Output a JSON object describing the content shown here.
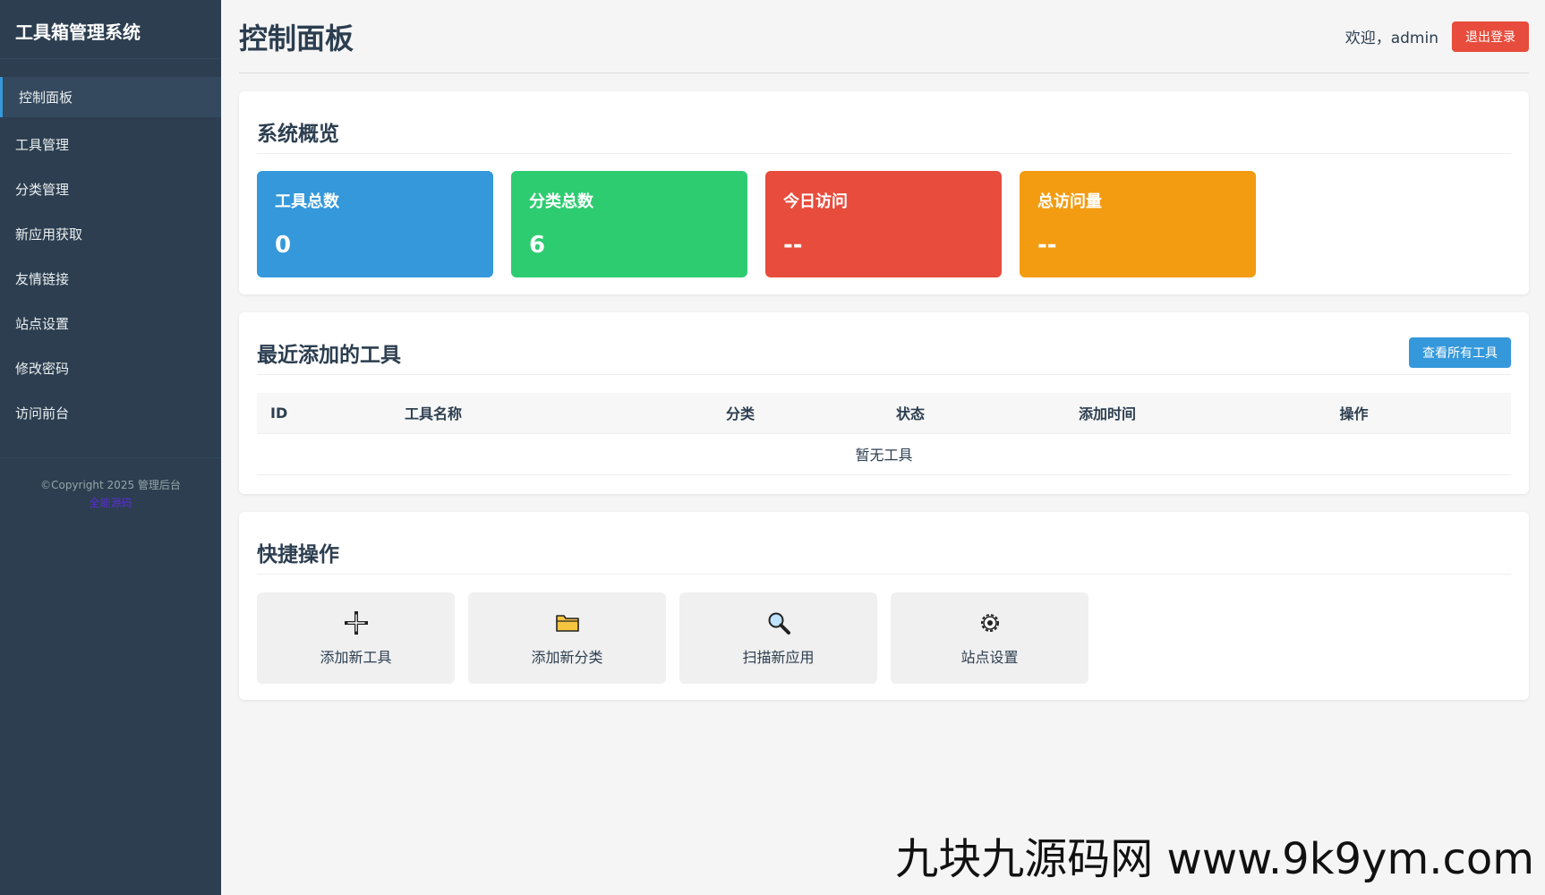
{
  "sidebar": {
    "brand": "工具箱管理系统",
    "items": [
      {
        "label": "控制面板",
        "active": true
      },
      {
        "label": "工具管理"
      },
      {
        "label": "分类管理"
      },
      {
        "label": "新应用获取"
      },
      {
        "label": "友情链接"
      },
      {
        "label": "站点设置"
      },
      {
        "label": "修改密码"
      },
      {
        "label": "访问前台"
      }
    ],
    "copyright": "©Copyright 2025 管理后台",
    "footer_link": "全能源码"
  },
  "header": {
    "title": "控制面板",
    "welcome": "欢迎，admin",
    "logout_label": "退出登录"
  },
  "overview": {
    "title": "系统概览",
    "stats": [
      {
        "label": "工具总数",
        "value": "0",
        "color": "#3498db"
      },
      {
        "label": "分类总数",
        "value": "6",
        "color": "#2ecc71"
      },
      {
        "label": "今日访问",
        "value": "--",
        "color": "#e74c3c"
      },
      {
        "label": "总访问量",
        "value": "--",
        "color": "#f39c12"
      }
    ]
  },
  "recent": {
    "title": "最近添加的工具",
    "view_all_label": "查看所有工具",
    "columns": [
      "ID",
      "工具名称",
      "分类",
      "状态",
      "添加时间",
      "操作"
    ],
    "empty_text": "暂无工具"
  },
  "quick": {
    "title": "快捷操作",
    "actions": [
      {
        "label": "添加新工具",
        "icon": "plus-icon"
      },
      {
        "label": "添加新分类",
        "icon": "folder-icon"
      },
      {
        "label": "扫描新应用",
        "icon": "magnifier-icon"
      },
      {
        "label": "站点设置",
        "icon": "gear-icon"
      }
    ]
  },
  "watermark": "九块九源码网 www.9k9ym.com"
}
